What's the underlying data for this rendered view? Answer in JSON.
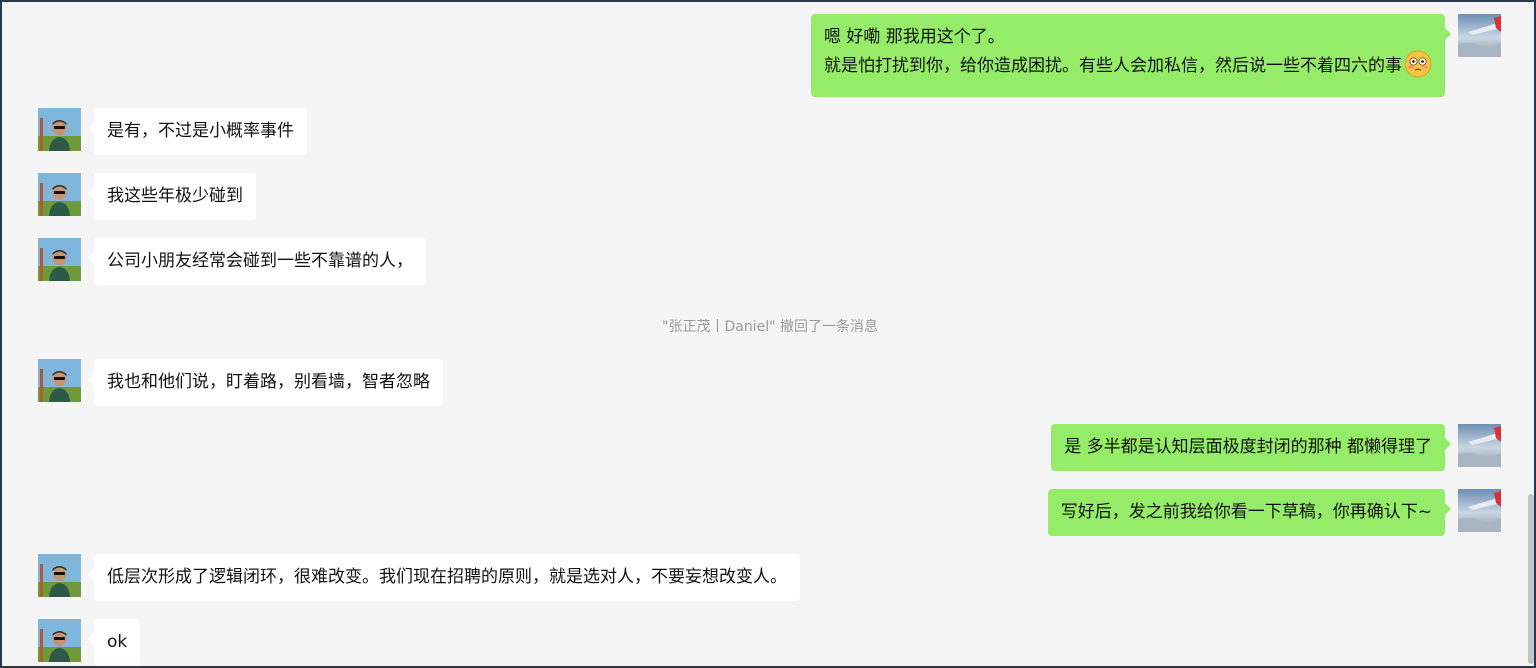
{
  "colors": {
    "self_bubble": "#95ec69",
    "other_bubble": "#ffffff",
    "background": "#f5f5f5",
    "system_text": "#9a9a9a"
  },
  "messages": [
    {
      "sender": "self",
      "lines": [
        "嗯 好嘞 那我用这个了。",
        "就是怕打扰到你，给你造成困扰。有些人会加私信，然后说一些不着四六的事"
      ],
      "emoji": "flushed-face-icon"
    },
    {
      "sender": "other",
      "text": "是有，不过是小概率事件"
    },
    {
      "sender": "other",
      "text": "我这些年极少碰到"
    },
    {
      "sender": "other",
      "text": "公司小朋友经常会碰到一些不靠谱的人，"
    },
    {
      "sender": "other",
      "text": "我也和他们说，盯着路，别看墙，智者忽略"
    },
    {
      "sender": "self",
      "text": "是 多半都是认知层面极度封闭的那种 都懒得理了"
    },
    {
      "sender": "self",
      "text": "写好后，发之前我给你看一下草稿，你再确认下~"
    },
    {
      "sender": "other",
      "text": "低层次形成了逻辑闭环，很难改变。我们现在招聘的原则，就是选对人，不要妄想改变人。"
    },
    {
      "sender": "other",
      "text": "ok"
    }
  ],
  "system_notice": "\"张正茂丨Daniel\" 撤回了一条消息",
  "icons": {
    "self_avatar": "airplane-wing-sky-avatar",
    "other_avatar": "man-sunglasses-outdoor-avatar"
  }
}
